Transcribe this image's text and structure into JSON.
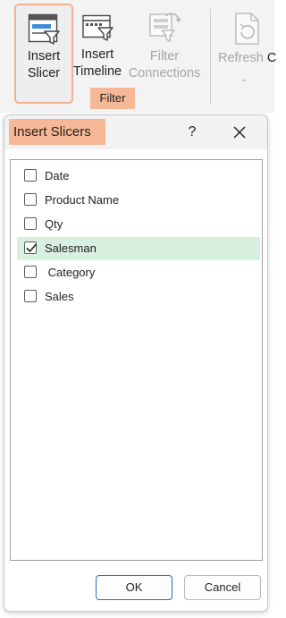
{
  "ribbon": {
    "insert_slicer": {
      "line1": "Insert",
      "line2": "Slicer"
    },
    "insert_timeline": {
      "line1": "Insert",
      "line2": "Timeline"
    },
    "filter_connections": {
      "line1": "Filter",
      "line2": "Connections"
    },
    "refresh": {
      "label": "Refresh",
      "overflow": "C"
    },
    "group_label": "Filter"
  },
  "dialog": {
    "title": "Insert Slicers",
    "help": "?",
    "fields": [
      {
        "label": "Date",
        "checked": false
      },
      {
        "label": "Product Name",
        "checked": false
      },
      {
        "label": "Qty",
        "checked": false
      },
      {
        "label": "Salesman",
        "checked": true
      },
      {
        "label": " Category",
        "checked": false
      },
      {
        "label": "Sales",
        "checked": false
      }
    ],
    "ok_label": "OK",
    "cancel_label": "Cancel"
  },
  "colors": {
    "highlight": "#f6b896",
    "selected_row": "#d8f0df",
    "accent": "#2f6cb5"
  }
}
